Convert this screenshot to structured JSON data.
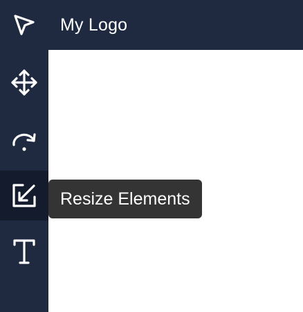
{
  "header": {
    "logo_text": "My Logo"
  },
  "toolbar": {
    "tools": [
      {
        "id": "select",
        "icon": "select-arrow-icon",
        "active": false
      },
      {
        "id": "move",
        "icon": "move-arrows-icon",
        "active": false
      },
      {
        "id": "rotate",
        "icon": "rotate-icon",
        "active": false
      },
      {
        "id": "resize",
        "icon": "resize-icon",
        "active": true,
        "tooltip": "Resize Elements"
      },
      {
        "id": "text",
        "icon": "text-icon",
        "active": false
      }
    ]
  },
  "tooltip": {
    "text": "Resize Elements"
  },
  "colors": {
    "sidebar_bg": "#1f2940",
    "active_tool_bg": "#131b2d",
    "tooltip_bg": "#343434",
    "icon_color": "#ffffff",
    "canvas_bg": "#ffffff"
  }
}
